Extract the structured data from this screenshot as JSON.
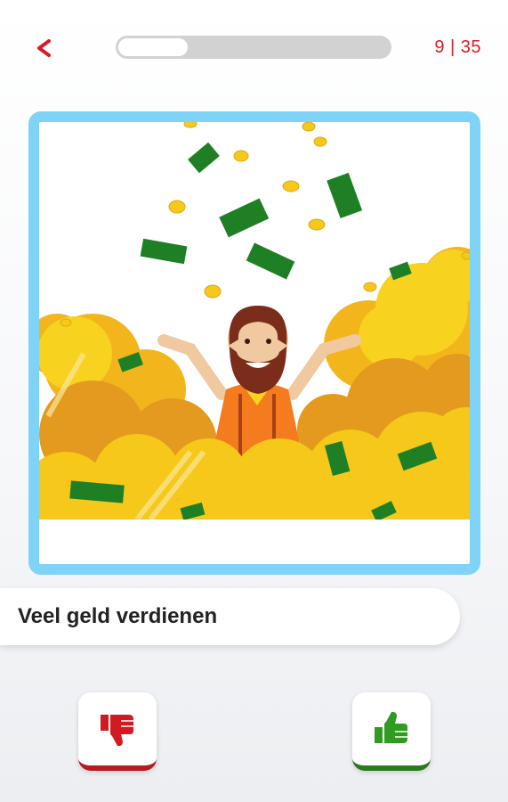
{
  "header": {
    "back_icon": "chevron-left-icon",
    "progress": {
      "current": 9,
      "total": 35
    },
    "counter_label": "9 | 35"
  },
  "card": {
    "illustration": "man-in-pile-of-money-illustration"
  },
  "statement": {
    "text": "Veel geld verdienen"
  },
  "actions": {
    "dislike_icon": "thumbs-down-icon",
    "like_icon": "thumbs-up-icon"
  },
  "colors": {
    "accent_red": "#dd1a22",
    "card_border": "#7fd3f7",
    "like_green": "#2e9c1f",
    "dislike_red": "#d21b20",
    "gold": "#f5c81a",
    "money_green": "#1f7f24"
  }
}
